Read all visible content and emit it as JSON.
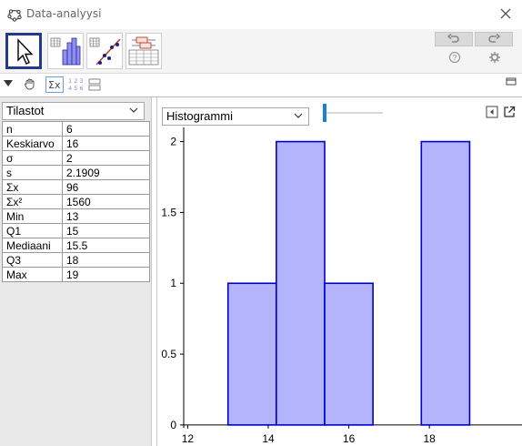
{
  "window": {
    "title": "Data-analyysi"
  },
  "left": {
    "dropdown_value": "Tilastot",
    "stats": [
      {
        "key": "n",
        "value": "6"
      },
      {
        "key": "Keskiarvo",
        "value": "16"
      },
      {
        "key": "σ",
        "value": "2"
      },
      {
        "key": "s",
        "value": "2.1909"
      },
      {
        "key": "Σx",
        "value": "96"
      },
      {
        "key": "Σx²",
        "value": "1560"
      },
      {
        "key": "Min",
        "value": "13"
      },
      {
        "key": "Q1",
        "value": "15"
      },
      {
        "key": "Mediaani",
        "value": "15.5"
      },
      {
        "key": "Q3",
        "value": "18"
      },
      {
        "key": "Max",
        "value": "19"
      }
    ]
  },
  "right": {
    "chart_type_value": "Histogrammi",
    "numbers_toggle": "1 2 3\n4 5 6"
  },
  "colors": {
    "bar_fill": "#b3b4fb",
    "bar_stroke": "#0000cc",
    "selected_tool": "#233a8c",
    "slider": "#1c7ed6"
  },
  "chart_data": {
    "type": "bar",
    "bins": [
      {
        "from": 13,
        "to": 14.2,
        "value": 1
      },
      {
        "from": 14.2,
        "to": 15.4,
        "value": 2
      },
      {
        "from": 15.4,
        "to": 16.6,
        "value": 1
      },
      {
        "from": 16.6,
        "to": 17.8,
        "value": 0
      },
      {
        "from": 17.8,
        "to": 19,
        "value": 2
      }
    ],
    "xticks": [
      "12",
      "14",
      "16",
      "18"
    ],
    "yticks": [
      "0",
      "0.5",
      "1",
      "1.5",
      "2"
    ],
    "xlim": [
      11.9,
      20.3
    ],
    "ylim": [
      -0.02,
      2.1
    ],
    "grid": false
  }
}
